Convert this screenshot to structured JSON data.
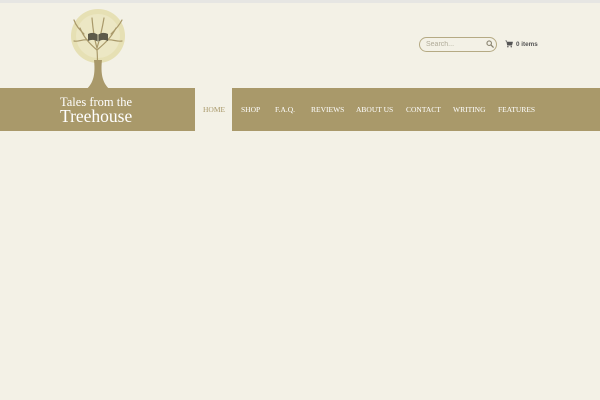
{
  "header": {
    "brand": {
      "line1": "Tales from the",
      "line2": "Treehouse",
      "logo_icon": "tree-book-logo-icon"
    },
    "search": {
      "placeholder": "Search...",
      "value": "",
      "icon": "search-icon"
    },
    "cart": {
      "icon": "cart-icon",
      "label": "0 items"
    }
  },
  "nav": {
    "items": [
      {
        "label": "HOME",
        "active": true
      },
      {
        "label": "SHOP",
        "active": false
      },
      {
        "label": "F.A.Q.",
        "active": false
      },
      {
        "label": "REVIEWS",
        "active": false
      },
      {
        "label": "ABOUT US",
        "active": false
      },
      {
        "label": "CONTACT",
        "active": false
      },
      {
        "label": "WRITING",
        "active": false
      },
      {
        "label": "FEATURES",
        "active": false
      }
    ]
  },
  "colors": {
    "background": "#f3f1e6",
    "brand_band": "#a9996a",
    "nav_text": "#ffffff",
    "active_nav_text": "#a9996a",
    "cart_text": "#555555"
  }
}
